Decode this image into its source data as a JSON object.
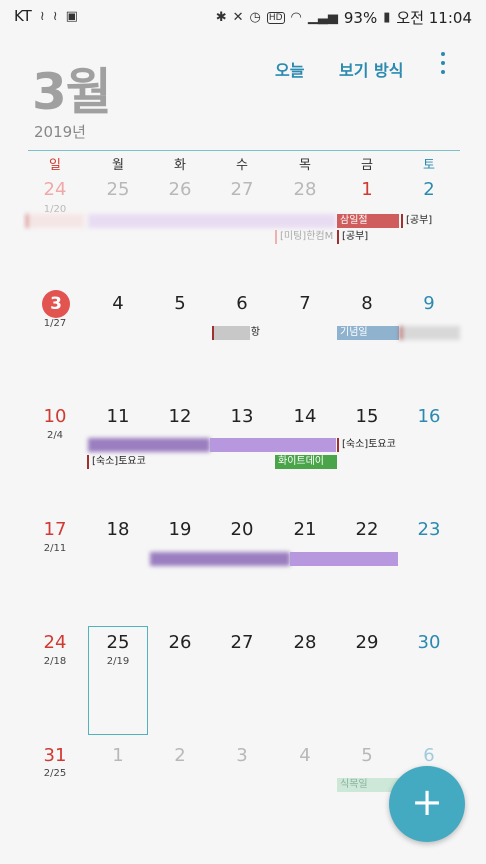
{
  "status": {
    "carrier": "KT",
    "battery": "93%",
    "time": "오전 11:04",
    "hd": "HD"
  },
  "header": {
    "month": "3월",
    "year": "2019년",
    "today_btn": "오늘",
    "view_btn": "보기 방식"
  },
  "weekdays": [
    "일",
    "월",
    "화",
    "수",
    "목",
    "금",
    "토"
  ],
  "weeks": [
    [
      "24",
      "25",
      "26",
      "27",
      "28",
      "1",
      "2"
    ],
    [
      "3",
      "4",
      "5",
      "6",
      "7",
      "8",
      "9"
    ],
    [
      "10",
      "11",
      "12",
      "13",
      "14",
      "15",
      "16"
    ],
    [
      "17",
      "18",
      "19",
      "20",
      "21",
      "22",
      "23"
    ],
    [
      "24",
      "25",
      "26",
      "27",
      "28",
      "29",
      "30"
    ],
    [
      "31",
      "1",
      "2",
      "3",
      "4",
      "5",
      "6"
    ]
  ],
  "lunar": {
    "w0": "1/20",
    "w1": "1/27",
    "w2": "2/4",
    "w3": "2/11",
    "w4": "2/18",
    "w4_mon": "2/19",
    "w5": "2/25"
  },
  "events": {
    "samiljeol": "삼일절",
    "study1": "[공부]",
    "study2": "[공부]",
    "meeting": "[미팅]한컴M",
    "hang": "항",
    "ginyeomil": "기념일",
    "sukso1": "[숙소]토요코",
    "sukso2": "[숙소]토요코",
    "whiteday": "화이트데이",
    "sikmokil": "식목일"
  },
  "fab": "+",
  "colors": {
    "accent": "#2b8ab0",
    "sunday": "#d03a32",
    "today": "#e2544f",
    "fab": "#44aac2"
  }
}
